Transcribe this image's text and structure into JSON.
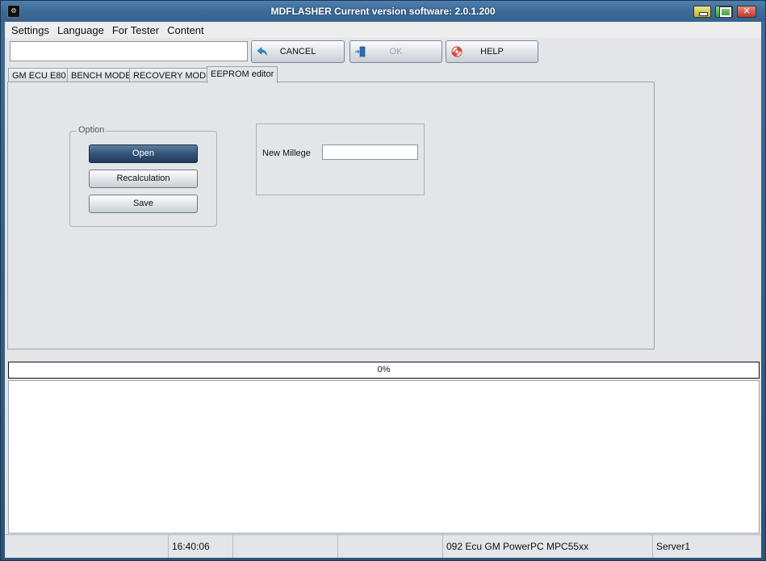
{
  "window": {
    "title": "MDFLASHER  Current version software: 2.0.1.200",
    "icon": "app-logo-icon"
  },
  "menu": [
    "Settings",
    "Language",
    "For Tester",
    "Content"
  ],
  "toolbar": {
    "path_value": "",
    "cancel_label": "CANCEL",
    "ok_label": "OK",
    "help_label": "HELP",
    "cancel_icon": "arrow-back-icon",
    "ok_icon": "door-exit-icon",
    "help_icon": "lifebuoy-icon"
  },
  "tabs": [
    "GM ECU E80",
    "BENCH MODE",
    "RECOVERY MODE",
    "EEPROM editor"
  ],
  "active_tab": "EEPROM editor",
  "eeprom": {
    "option_group_title": "Option",
    "open_label": "Open",
    "recalc_label": "Recalculation",
    "save_label": "Save",
    "mileage_label": "New Millege",
    "mileage_value": ""
  },
  "progress": {
    "text": "0%",
    "value": 0
  },
  "log": {
    "lines": []
  },
  "status": {
    "cell1": "",
    "time": "16:40:06",
    "cell3": "",
    "cell4": "",
    "ecu": "092 Ecu GM PowerPC MPC55xx",
    "server": "Server1"
  },
  "colors": {
    "title_bar": "#3d6b98",
    "focused_button": "#34557a",
    "client_bg": "#e3e5e8"
  }
}
